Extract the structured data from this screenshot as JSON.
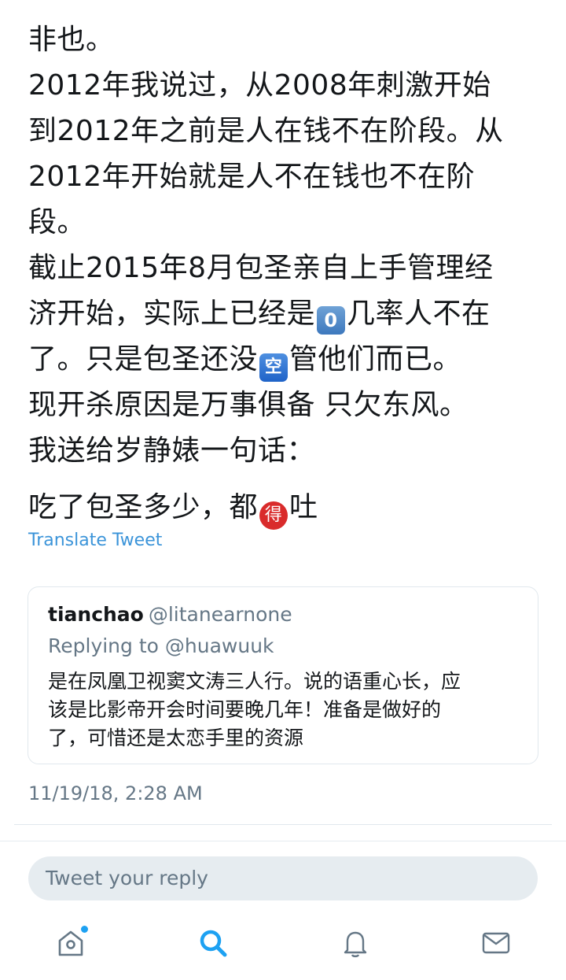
{
  "tweet": {
    "lines": [
      "非也。",
      "2012年我说过，从2008年刺激开始",
      "到2012年之前是人在钱不在阶段。从",
      "2012年开始就是人不在钱也不在阶",
      "段。",
      "截止2015年8月包圣亲自上手管理经"
    ],
    "line7_before": "济开始，实际上已经是",
    "line7_emoji": "0",
    "line7_after": "几率人不在",
    "line8_before": "了。只是包圣还没",
    "line8_emoji": "空",
    "line8_after": "管他们而已。",
    "line9": "现开杀原因是万事俱备 只欠东风。",
    "line10": "我送给岁静婊一句话：",
    "last_before": "吃了包圣多少，都",
    "last_emoji": "得",
    "last_after": "吐"
  },
  "translate_label": "Translate Tweet",
  "quote": {
    "name": "tianchao",
    "handle": "@litanearnone",
    "replying": "Replying to @huawuuk",
    "lines": [
      "是在凤凰卫视窦文涛三人行。说的语重心长，应",
      "该是比影帝开会时间要晚几年！准备是做好的",
      "了，可惜还是太恋手里的资源"
    ]
  },
  "timestamp": "11/19/18, 2:28 AM",
  "reply_placeholder": "Tweet your reply",
  "tabs": {
    "home_icon": "home-icon",
    "search_icon": "search-icon",
    "notifications_icon": "bell-icon",
    "messages_icon": "mail-icon",
    "active_color": "#1da1f2",
    "inactive_color": "#657786"
  }
}
